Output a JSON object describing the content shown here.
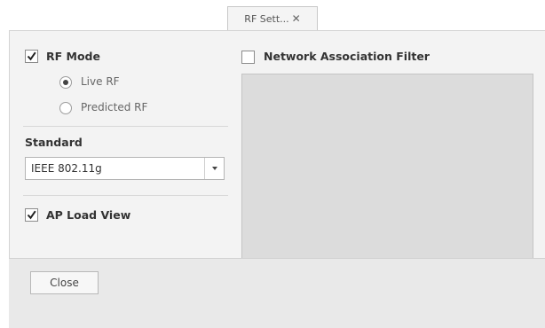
{
  "tab": {
    "label": "RF Sett...",
    "close_glyph": "✕"
  },
  "rf_mode": {
    "label": "RF Mode",
    "checked": true,
    "options": [
      {
        "label": "Live RF",
        "selected": true
      },
      {
        "label": "Predicted RF",
        "selected": false
      }
    ]
  },
  "standard": {
    "label": "Standard",
    "value": "IEEE 802.11g"
  },
  "ap_load_view": {
    "label": "AP Load View",
    "checked": true
  },
  "network_filter": {
    "label": "Network Association Filter",
    "checked": false
  },
  "footer": {
    "close_label": "Close"
  },
  "icons": {
    "check": "check-icon",
    "dropdown": "chevron-down-icon",
    "tab_close": "close-icon"
  },
  "colors": {
    "panel_background": "#f3f3f3",
    "filter_box_background": "#dcdcdc",
    "footer_background": "#e9e9e9"
  }
}
